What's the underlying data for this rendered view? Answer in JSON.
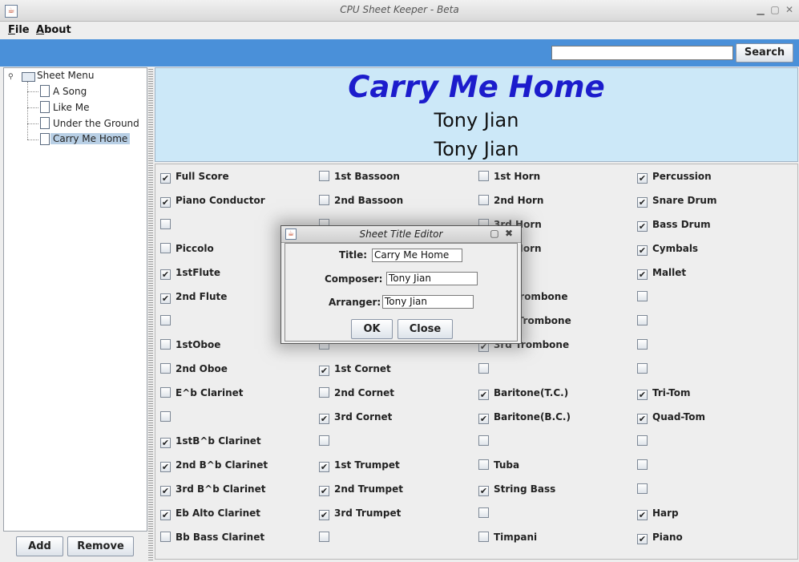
{
  "window": {
    "title": "CPU Sheet Keeper - Beta",
    "app_icon_glyph": "☕"
  },
  "menubar": {
    "items": [
      {
        "label": "File"
      },
      {
        "label": "About"
      }
    ]
  },
  "search": {
    "value": "",
    "button_label": "Search"
  },
  "tree": {
    "root_label": "Sheet Menu",
    "items": [
      {
        "label": "A Song",
        "selected": false
      },
      {
        "label": "Like Me",
        "selected": false
      },
      {
        "label": "Under the Ground",
        "selected": false
      },
      {
        "label": "Carry Me Home",
        "selected": true
      }
    ]
  },
  "left_buttons": {
    "add_label": "Add",
    "remove_label": "Remove"
  },
  "sheet": {
    "title": "Carry Me Home",
    "composer": "Tony Jian",
    "arranger": "Tony Jian",
    "title_color": "#1c1ccc",
    "header_bg": "#cce8f8"
  },
  "parts": {
    "columns": [
      [
        {
          "label": "Full Score",
          "checked": true
        },
        {
          "label": "Piano Conductor",
          "checked": true
        },
        {
          "label": "",
          "checked": false
        },
        {
          "label": "Piccolo",
          "checked": false
        },
        {
          "label": "1stFlute",
          "checked": true
        },
        {
          "label": "2nd Flute",
          "checked": true
        },
        {
          "label": "",
          "checked": false
        },
        {
          "label": "1stOboe",
          "checked": false
        },
        {
          "label": "2nd Oboe",
          "checked": false
        },
        {
          "label": "E^b Clarinet",
          "checked": false
        },
        {
          "label": "",
          "checked": false
        },
        {
          "label": "1stB^b Clarinet",
          "checked": true
        },
        {
          "label": "2nd B^b Clarinet",
          "checked": true
        },
        {
          "label": "3rd B^b Clarinet",
          "checked": true
        },
        {
          "label": "Eb Alto Clarinet",
          "checked": true
        },
        {
          "label": "Bb Bass Clarinet",
          "checked": false
        }
      ],
      [
        {
          "label": "1st Bassoon",
          "checked": false
        },
        {
          "label": "2nd Bassoon",
          "checked": false
        },
        {
          "label": "",
          "checked": false
        },
        {
          "label": "",
          "checked": false
        },
        {
          "label": "",
          "checked": false
        },
        {
          "label": "",
          "checked": false
        },
        {
          "label": "",
          "checked": false
        },
        {
          "label": "",
          "checked": false
        },
        {
          "label": "1st Cornet",
          "checked": true
        },
        {
          "label": "2nd Cornet",
          "checked": false
        },
        {
          "label": "3rd Cornet",
          "checked": true
        },
        {
          "label": "",
          "checked": false
        },
        {
          "label": "1st Trumpet",
          "checked": true
        },
        {
          "label": "2nd Trumpet",
          "checked": true
        },
        {
          "label": "3rd Trumpet",
          "checked": true
        },
        {
          "label": "",
          "checked": false
        }
      ],
      [
        {
          "label": "1st Horn",
          "checked": false
        },
        {
          "label": "2nd Horn",
          "checked": false
        },
        {
          "label": "3rd Horn",
          "checked": false
        },
        {
          "label": "4th Horn",
          "checked": false
        },
        {
          "label": "",
          "checked": false
        },
        {
          "label": "1st Trombone",
          "checked": false
        },
        {
          "label": "2nd Trombone",
          "checked": false
        },
        {
          "label": "3rd Trombone",
          "checked": true
        },
        {
          "label": "",
          "checked": false
        },
        {
          "label": "Baritone(T.C.)",
          "checked": true
        },
        {
          "label": "Baritone(B.C.)",
          "checked": true
        },
        {
          "label": "",
          "checked": false
        },
        {
          "label": "Tuba",
          "checked": false
        },
        {
          "label": "String Bass",
          "checked": true
        },
        {
          "label": "",
          "checked": false
        },
        {
          "label": "Timpani",
          "checked": false
        }
      ],
      [
        {
          "label": "Percussion",
          "checked": true
        },
        {
          "label": "Snare Drum",
          "checked": true
        },
        {
          "label": "Bass Drum",
          "checked": true
        },
        {
          "label": "Cymbals",
          "checked": true
        },
        {
          "label": "Mallet",
          "checked": true
        },
        {
          "label": "",
          "checked": false
        },
        {
          "label": "",
          "checked": false
        },
        {
          "label": "",
          "checked": false
        },
        {
          "label": "",
          "checked": false
        },
        {
          "label": "Tri-Tom",
          "checked": true
        },
        {
          "label": "Quad-Tom",
          "checked": true
        },
        {
          "label": "",
          "checked": false
        },
        {
          "label": "",
          "checked": false
        },
        {
          "label": "",
          "checked": false
        },
        {
          "label": "Harp",
          "checked": true
        },
        {
          "label": "Piano",
          "checked": true
        }
      ]
    ]
  },
  "dialog": {
    "title": "Sheet Title Editor",
    "title_label": "Title:",
    "title_value": "Carry Me Home",
    "composer_label": "Composer:",
    "composer_value": "Tony Jian",
    "arranger_label": "Arranger:",
    "arranger_value": "Tony Jian",
    "ok_label": "OK",
    "close_label": "Close"
  }
}
